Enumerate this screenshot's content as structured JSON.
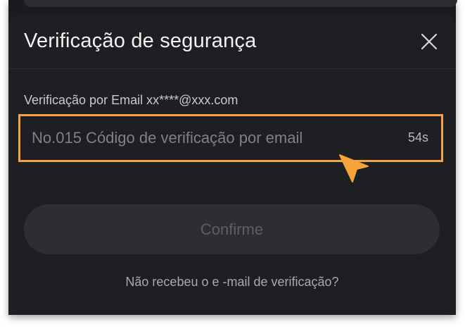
{
  "dialog": {
    "title": "Verificação de segurança",
    "close_icon": "close-icon"
  },
  "email_verification": {
    "label": "Verificação por Email xx****@xxx.com",
    "input_value": "",
    "input_placeholder": "No.015 Código de verificação por email",
    "countdown": "54s"
  },
  "confirm_button": {
    "label": "Confirme",
    "enabled": false
  },
  "resend_link": {
    "label": "Não recebeu o e -mail de verificação?"
  },
  "colors": {
    "background": "#1e1f23",
    "highlight": "#f5a33a",
    "button_disabled": "#2d2e33"
  },
  "icons": {
    "cursor": "pointer-cursor-icon"
  }
}
